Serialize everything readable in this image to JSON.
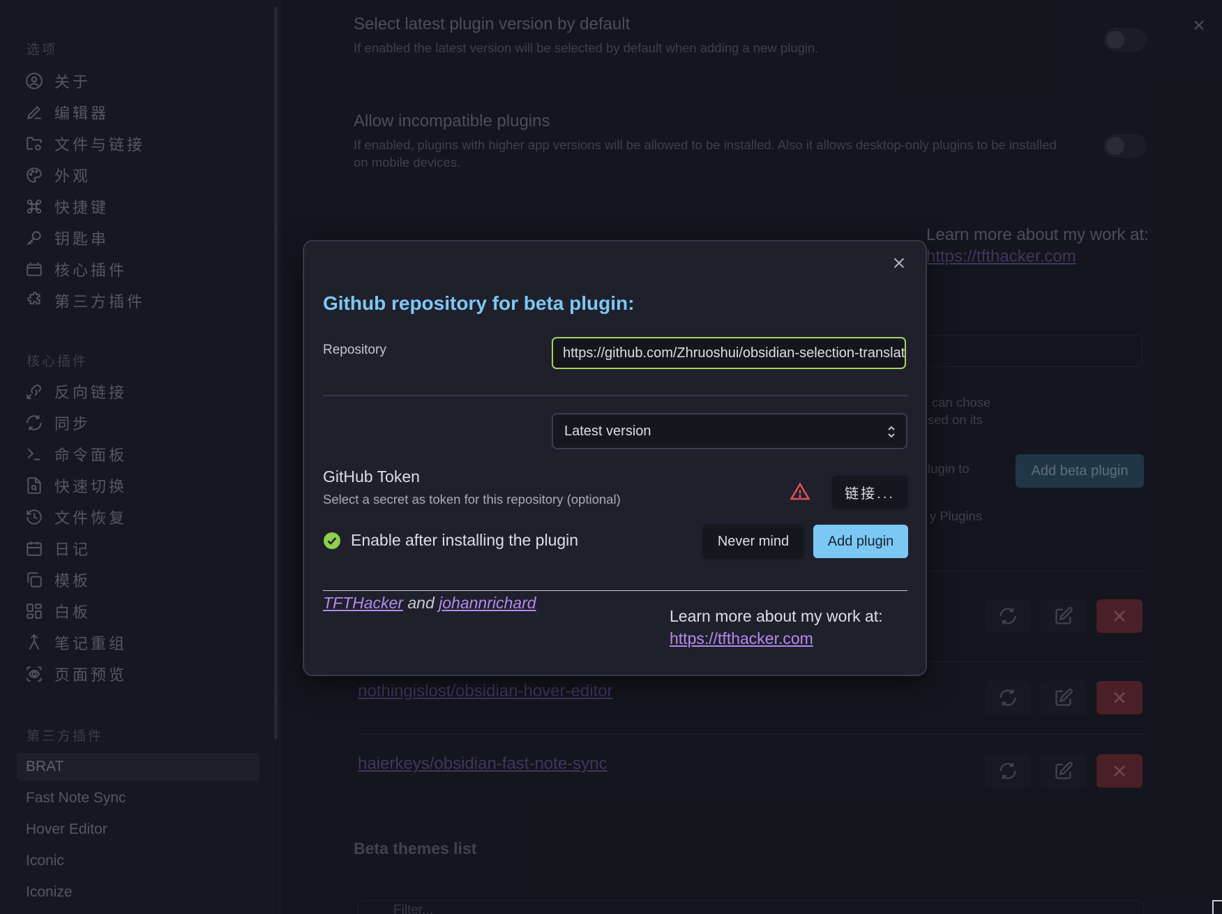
{
  "sidebar": {
    "options_title": "选项",
    "options": [
      {
        "label": "关于",
        "icon": "user-circle-icon"
      },
      {
        "label": "编辑器",
        "icon": "pencil-icon"
      },
      {
        "label": "文件与链接",
        "icon": "folder-cog-icon"
      },
      {
        "label": "外观",
        "icon": "palette-icon"
      },
      {
        "label": "快捷键",
        "icon": "command-icon"
      },
      {
        "label": "钥匙串",
        "icon": "key-icon"
      },
      {
        "label": "核心插件",
        "icon": "calendar-box-icon"
      },
      {
        "label": "第三方插件",
        "icon": "puzzle-icon"
      }
    ],
    "core_title": "核心插件",
    "core_plugins": [
      {
        "label": "反向链接",
        "icon": "backlink-icon"
      },
      {
        "label": "同步",
        "icon": "sync-icon"
      },
      {
        "label": "命令面板",
        "icon": "terminal-icon"
      },
      {
        "label": "快速切换",
        "icon": "file-search-icon"
      },
      {
        "label": "文件恢复",
        "icon": "history-icon"
      },
      {
        "label": "日记",
        "icon": "calendar-icon"
      },
      {
        "label": "模板",
        "icon": "copy-icon"
      },
      {
        "label": "白板",
        "icon": "layout-dashboard-icon"
      },
      {
        "label": "笔记重组",
        "icon": "merge-icon"
      },
      {
        "label": "页面预览",
        "icon": "scan-eye-icon"
      }
    ],
    "third_title": "第三方插件",
    "third_plugins": [
      "BRAT",
      "Fast Note Sync",
      "Hover Editor",
      "Iconic",
      "Iconize"
    ]
  },
  "main": {
    "setting1_name": "Select latest plugin version by default",
    "setting1_desc": "If enabled the latest version will be selected by default when adding a new plugin.",
    "setting2_name": "Allow incompatible plugins",
    "setting2_desc_line1": "If enabled, plugins with higher app versions will be allowed to be installed. Also it allows desktop-only plugins to be installed",
    "setting2_desc_line2": "on mobile devices.",
    "learn_more": "Learn more about my work at:",
    "learn_more_link": "https://tfthacker.com",
    "partial_text_1": "can chose",
    "partial_text_2": "sed on its",
    "partial_text_3": "lugin to",
    "partial_text_4": "y Plugins",
    "add_beta_plugin": "Add beta plugin",
    "plugin_rows": [
      "nothingislost/obsidian-hover-editor",
      "haierkeys/obsidian-fast-note-sync"
    ],
    "beta_themes_heading": "Beta themes list",
    "filter_placeholder": "Filter..."
  },
  "modal": {
    "title": "Github repository for beta plugin:",
    "repo_label": "Repository",
    "repo_value": "https://github.com/Zhruoshui/obsidian-selection-translator",
    "version_value": "Latest version",
    "token_title": "GitHub Token",
    "token_desc": "Select a secret as token for this repository (optional)",
    "link_button": "链接...",
    "enable_label": "Enable after installing the plugin",
    "never_mind": "Never mind",
    "add_plugin": "Add plugin",
    "author1": "TFTHacker",
    "and_text": " and ",
    "author2": "johannrichard",
    "learn_more": "Learn more about my work at:",
    "learn_more_link": "https://tfthacker.com"
  },
  "colors": {
    "accent": "#7cc8f4",
    "link": "#b38bf0",
    "success": "#8fce4f",
    "danger": "#e0515c"
  }
}
